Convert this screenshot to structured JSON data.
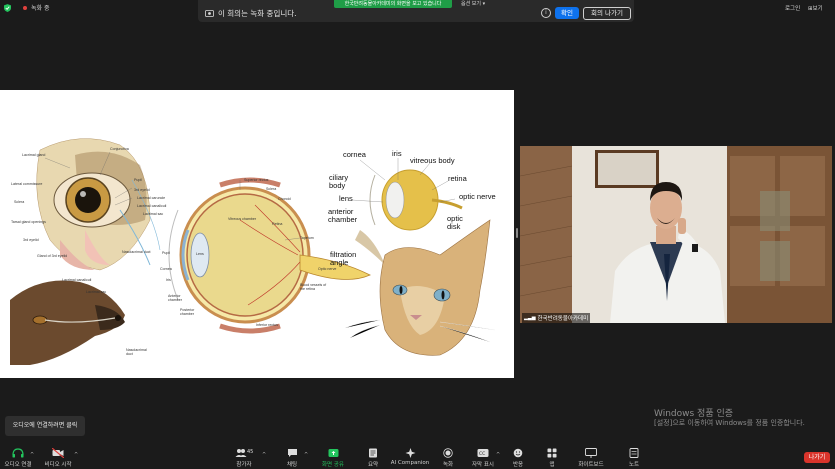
{
  "top_bar": {
    "recording_label": "녹화 중",
    "green_banner": "한국반려동물아카데미의 화면을 보고 있습니다",
    "view_options": "옵션 보기",
    "recording_notice": "이 회의는 녹화 중입니다.",
    "ok_button": "확인",
    "leave_meeting_button": "회의 나가기",
    "right_item_1": "로그인",
    "right_item_2": "보기"
  },
  "slide": {
    "dog_eye_labels": [
      "Lacrimal gland",
      "Conjunctiva",
      "Lateral commissure",
      "Pupil",
      "3rd eyelid",
      "Lacrimal caruncle",
      "Lacrimal canaliculi",
      "Lacrimal sac",
      "Sclera",
      "Tarsal gland openings",
      "3rd eyelid",
      "Nasolacrimal duct",
      "Gland of 3rd eyelid"
    ],
    "cross_section_labels": [
      "Superior rectus",
      "Sclera",
      "Choroid",
      "Vitreous chamber",
      "Retina",
      "Tapetum",
      "Pupil",
      "Cornea",
      "Iris",
      "Lens",
      "Anterior chamber",
      "Posterior chamber",
      "Optic nerve",
      "Blood vessels of the retina",
      "Inferior rectus"
    ],
    "dog_head_labels": [
      "Lacrimal canaliculi",
      "Lacrimal sac",
      "Nasolacrimal duct"
    ],
    "cat_eye_labels": {
      "cornea": "cornea",
      "iris": "iris",
      "vitreous_body": "vitreous body",
      "ciliary_body": "ciliary body",
      "retina": "retina",
      "lens": "lens",
      "optic_nerve": "optic nerve",
      "anterior_chamber": "anterior chamber",
      "optic_disk": "optic disk",
      "filtration_angle": "filtration angle"
    }
  },
  "video": {
    "participant_name": "한국반려동물아카데미"
  },
  "tooltip": "오디오에 연결하려면 클릭",
  "watermark": {
    "title": "Windows 정품 인증",
    "subtitle": "[설정]으로 이동하여 Windows를 정품 인증합니다."
  },
  "toolbar": {
    "audio": "오디오 연결",
    "video": "비디오 시작",
    "participants": "참가자",
    "participants_count": "45",
    "chat": "채팅",
    "share_screen": "화면 공유",
    "summary": "요약",
    "ai_companion": "AI Companion",
    "record": "녹화",
    "captions": "자막 표시",
    "reactions": "반응",
    "apps": "앱",
    "whiteboard": "화이트보드",
    "notes": "노트",
    "exit": "나가기"
  },
  "colors": {
    "background": "#1b1b1b",
    "primary_blue": "#0e72ed",
    "exit_red": "#d9342b",
    "green_banner": "#1f9d47",
    "share_green": "#23c55e"
  }
}
